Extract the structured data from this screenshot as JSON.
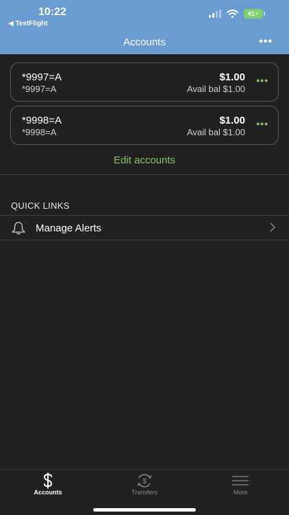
{
  "status": {
    "time": "10:22",
    "back_app": "◀ TestFlight",
    "battery": "41"
  },
  "nav": {
    "title": "Accounts",
    "more": "•••"
  },
  "accounts": [
    {
      "name": "*9997=A",
      "sub": "*9997=A",
      "balance": "$1.00",
      "avail": "Avail bal $1.00",
      "menu": "•••"
    },
    {
      "name": "*9998=A",
      "sub": "*9998=A",
      "balance": "$1.00",
      "avail": "Avail bal $1.00",
      "menu": "•••"
    }
  ],
  "edit_accounts": "Edit accounts",
  "quick_links": {
    "title": "QUICK LINKS",
    "items": [
      {
        "label": "Manage Alerts",
        "icon": "bell-icon"
      }
    ]
  },
  "tabs": [
    {
      "label": "Accounts",
      "icon": "dollar-icon",
      "active": true
    },
    {
      "label": "Transfers",
      "icon": "transfer-icon",
      "active": false
    },
    {
      "label": "More",
      "icon": "menu-icon",
      "active": false
    }
  ],
  "colors": {
    "header": "#6a9bd1",
    "accent": "#8cc06a",
    "background": "#212121"
  }
}
